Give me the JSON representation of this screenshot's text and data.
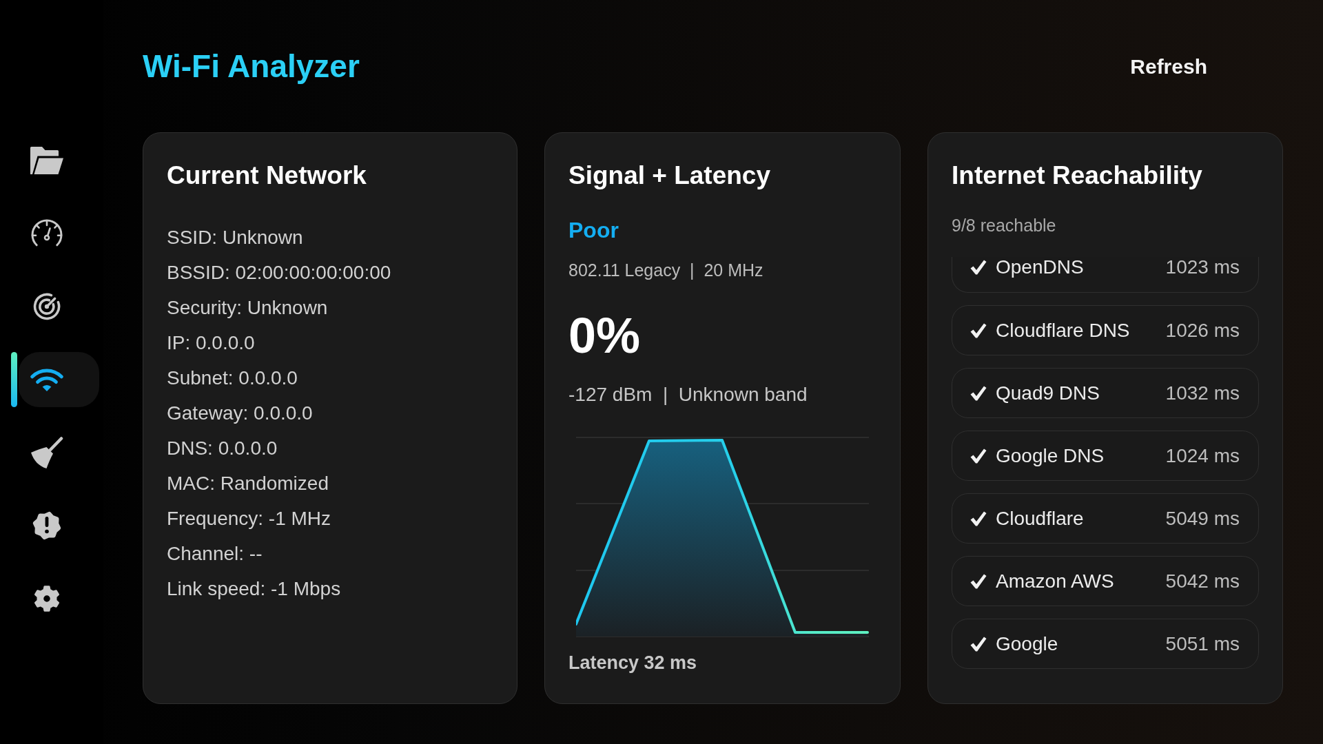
{
  "app": {
    "title": "Wi-Fi Analyzer",
    "refresh_button": "Refresh"
  },
  "sidebar": {
    "items": [
      {
        "selected": false
      },
      {
        "selected": false
      },
      {
        "selected": false
      },
      {
        "selected": true
      },
      {
        "selected": false
      },
      {
        "selected": false
      },
      {
        "selected": false
      }
    ]
  },
  "current_network": {
    "title": "Current Network",
    "details": [
      "SSID: Unknown",
      "BSSID: 02:00:00:00:00:00",
      "Security: Unknown",
      "IP: 0.0.0.0",
      "Subnet: 0.0.0.0",
      "Gateway: 0.0.0.0",
      "DNS: 0.0.0.0",
      "MAC: Randomized",
      "Frequency: -1 MHz",
      "Channel: --",
      "Link speed: -1 Mbps"
    ]
  },
  "signal_latency": {
    "title": "Signal + Latency",
    "quality": "Poor",
    "phy": "802.11 Legacy  |  20 MHz",
    "strength": "0%",
    "rssi": "-127 dBm  |  Unknown band",
    "latency": "Latency 32 ms"
  },
  "reachability": {
    "title": "Internet Reachability",
    "summary": "9/8 reachable",
    "targets": [
      {
        "name": "OpenDNS",
        "latency": "1023 ms",
        "reachable": true,
        "clipped": true
      },
      {
        "name": "Cloudflare DNS",
        "latency": "1026 ms",
        "reachable": true,
        "clipped": false
      },
      {
        "name": "Quad9 DNS",
        "latency": "1032 ms",
        "reachable": true,
        "clipped": false
      },
      {
        "name": "Google DNS",
        "latency": "1024 ms",
        "reachable": true,
        "clipped": false
      },
      {
        "name": "Cloudflare",
        "latency": "5049 ms",
        "reachable": true,
        "clipped": false
      },
      {
        "name": "Amazon AWS",
        "latency": "5042 ms",
        "reachable": true,
        "clipped": false
      },
      {
        "name": "Google",
        "latency": "5051 ms",
        "reachable": true,
        "clipped": false
      }
    ]
  }
}
